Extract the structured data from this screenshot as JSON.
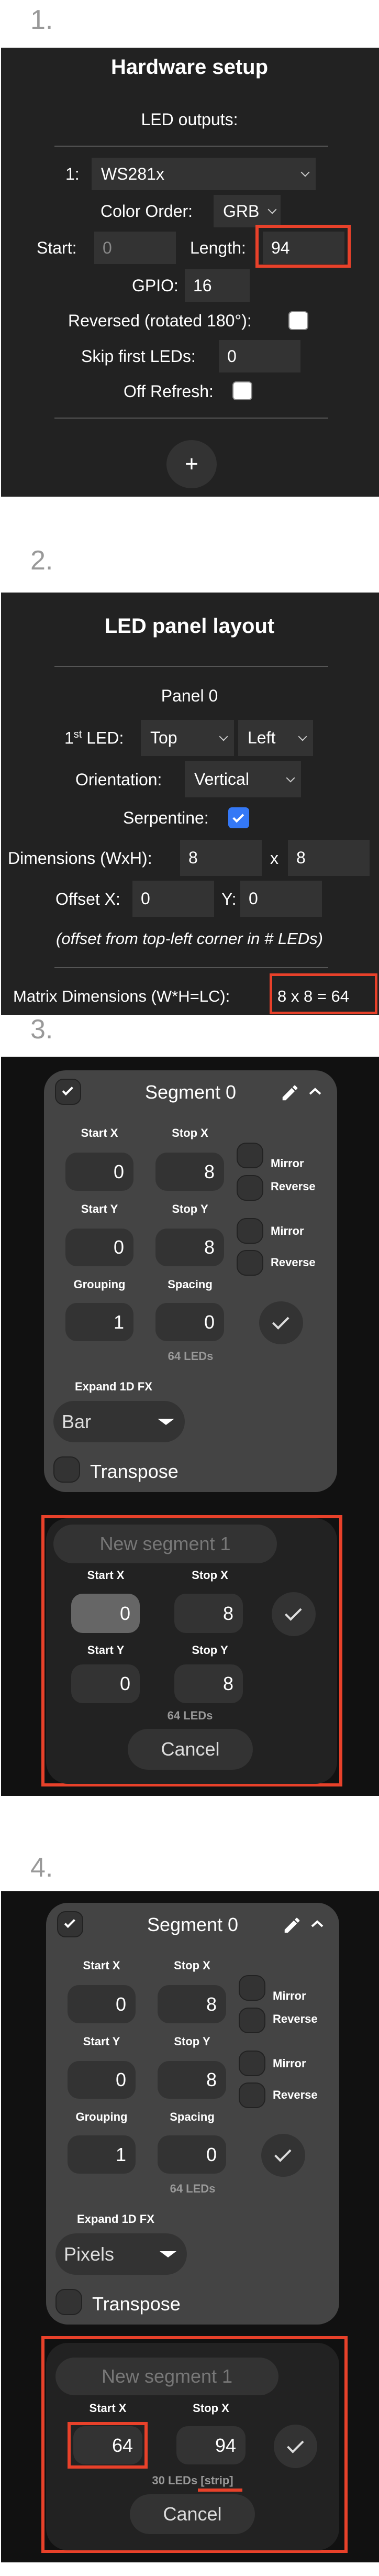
{
  "steps": [
    "1.",
    "2.",
    "3.",
    "4."
  ],
  "colors": {
    "accent_red": "#e8412a",
    "checkbox_blue": "#3478f6",
    "panel_bg": "#222222",
    "card_bg": "#444444"
  },
  "hardware": {
    "title": "Hardware setup",
    "led_outputs_label": "LED outputs:",
    "output_index": "1:",
    "led_type": "WS281x",
    "color_order_label": "Color Order:",
    "color_order": "GRB",
    "start_label": "Start:",
    "start_value": "0",
    "length_label": "Length:",
    "length_value": "94",
    "gpio_label": "GPIO:",
    "gpio_value": "16",
    "reversed_label": "Reversed (rotated 180°):",
    "reversed_checked": false,
    "skip_label": "Skip first LEDs:",
    "skip_value": "0",
    "off_refresh_label": "Off Refresh:",
    "off_refresh_checked": false,
    "add_label": "+"
  },
  "panel_layout": {
    "title": "LED panel layout",
    "panel_name": "Panel 0",
    "first_led_label": "1",
    "first_led_sup": "st",
    "first_led_suffix": " LED:",
    "first_led_vertical": "Top",
    "first_led_horizontal": "Left",
    "orientation_label": "Orientation:",
    "orientation": "Vertical",
    "serpentine_label": "Serpentine:",
    "serpentine_checked": true,
    "dimensions_label": "Dimensions (WxH):",
    "width": "8",
    "x_sep": "x",
    "height": "8",
    "offset_x_label": "Offset X:",
    "offset_x": "0",
    "offset_y_label": "Y:",
    "offset_y": "0",
    "offset_note": "(offset from top-left corner in # LEDs)",
    "matrix_label": "Matrix Dimensions (W*H=LC):",
    "matrix_value": "8 x 8 = 64"
  },
  "labels": {
    "start_x": "Start X",
    "stop_x": "Stop X",
    "start_y": "Start Y",
    "stop_y": "Stop Y",
    "grouping": "Grouping",
    "spacing": "Spacing",
    "mirror": "Mirror",
    "reverse": "Reverse",
    "expand": "Expand 1D FX",
    "transpose": "Transpose",
    "cancel": "Cancel",
    "new_segment_placeholder": "New segment 1"
  },
  "step3": {
    "segment": {
      "name": "Segment 0",
      "start_x": "0",
      "stop_x": "8",
      "start_y": "0",
      "stop_y": "8",
      "grouping": "1",
      "spacing": "0",
      "led_count": "64 LEDs",
      "expand_1d": "Bar"
    },
    "new_segment": {
      "start_x": "0",
      "stop_x": "8",
      "start_y": "0",
      "stop_y": "8",
      "led_count": "64 LEDs"
    }
  },
  "step4": {
    "segment": {
      "name": "Segment 0",
      "start_x": "0",
      "stop_x": "8",
      "start_y": "0",
      "stop_y": "8",
      "grouping": "1",
      "spacing": "0",
      "led_count": "64 LEDs",
      "expand_1d": "Pixels"
    },
    "new_segment": {
      "start_x": "64",
      "stop_x": "94",
      "led_count": "30 LEDs [strip]"
    }
  }
}
